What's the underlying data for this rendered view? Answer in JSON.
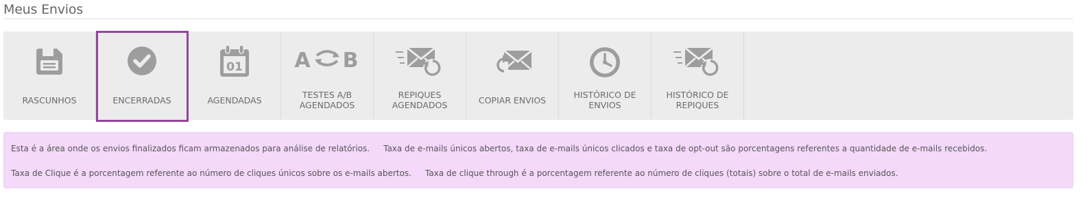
{
  "page": {
    "title": "Meus Envios"
  },
  "toolbar": {
    "items": [
      {
        "label": "RASCUNHOS",
        "icon": "floppy-disk-icon"
      },
      {
        "label": "ENCERRADAS",
        "icon": "check-circle-icon",
        "active": true
      },
      {
        "label": "AGENDADAS",
        "icon": "calendar-icon",
        "calendar_day": "01"
      },
      {
        "label": "TESTES A/B AGENDADOS",
        "icon": "ab-test-icon",
        "glyph_a": "A",
        "glyph_b": "B"
      },
      {
        "label": "REPIQUES AGENDADOS",
        "icon": "envelope-repeat-icon"
      },
      {
        "label": "COPIAR ENVIOS",
        "icon": "envelope-copy-icon"
      },
      {
        "label": "HISTÓRICO DE ENVIOS",
        "icon": "clock-icon"
      },
      {
        "label": "HISTÓRICO DE REPIQUES",
        "icon": "envelope-repeat-icon"
      }
    ]
  },
  "info": {
    "line1_a": "Esta é a área onde os envios finalizados ficam armazenados para análise de relatórios.",
    "line1_b": "Taxa de e-mails únicos abertos, taxa de e-mails únicos clicados e taxa de opt-out são porcentagens referentes a quantidade de e-mails recebidos.",
    "line2_a": "Taxa de Clique é a porcentagem referente ao número de cliques únicos sobre os e-mails abertos.",
    "line2_b": "Taxa de clique through é a porcentagem referente ao número de cliques (totais) sobre o total de e-mails enviados."
  },
  "colors": {
    "accent": "#93459b",
    "icon": "#9d9d9d",
    "toolbar_bg": "#ececec",
    "info_bg": "#f5d9fb"
  }
}
